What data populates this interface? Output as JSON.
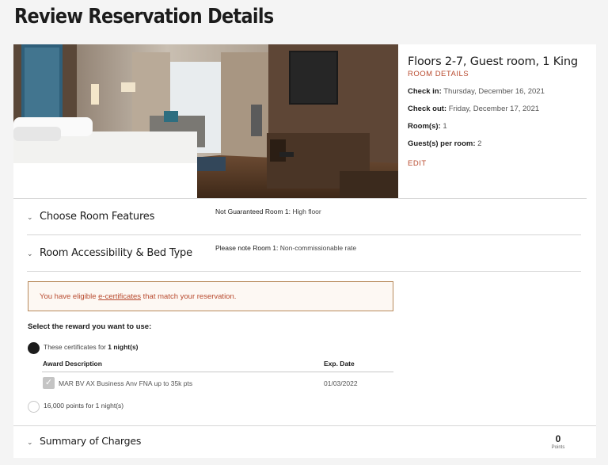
{
  "page": {
    "title": "Review Reservation Details"
  },
  "room": {
    "title": "Floors 2-7, Guest room, 1 King",
    "details_link": "ROOM DETAILS",
    "check_in_label": "Check in:",
    "check_in_value": "Thursday, December 16, 2021",
    "check_out_label": "Check out:",
    "check_out_value": "Friday, December 17, 2021",
    "rooms_label": "Room(s):",
    "rooms_value": "1",
    "guests_label": "Guest(s) per room:",
    "guests_value": "2",
    "edit_link": "EDIT"
  },
  "features": {
    "label": "Choose Room Features",
    "note_label": "Not Guaranteed Room 1:",
    "note_value": "High floor"
  },
  "accessibility": {
    "label": "Room Accessibility & Bed Type",
    "note_label": "Please note Room 1:",
    "note_value": "Non-commissionable rate"
  },
  "alert": {
    "prefix": "You have eligible ",
    "link": "e-certificates",
    "suffix": " that match your reservation."
  },
  "reward": {
    "heading": "Select the reward you want to use:",
    "option1_prefix": "These certificates for ",
    "option1_bold": "1 night(s)",
    "option1_selected": true,
    "table_headers": {
      "description": "Award Description",
      "exp_date": "Exp. Date"
    },
    "certificate": {
      "description": "MAR BV AX Business Anv FNA up to 35k pts",
      "exp_date": "01/03/2022",
      "checked": true
    },
    "option2": "16,000 points for 1 night(s)",
    "option2_selected": false
  },
  "summary": {
    "label": "Summary of Charges",
    "points_value": "0",
    "points_label": "Points"
  },
  "colors": {
    "accent": "#b84a2e",
    "alert_border": "#b88a5c",
    "text": "#1c1c1c"
  },
  "icons": {
    "accordion": "chevron-down-icon",
    "checkbox": "check-icon"
  }
}
